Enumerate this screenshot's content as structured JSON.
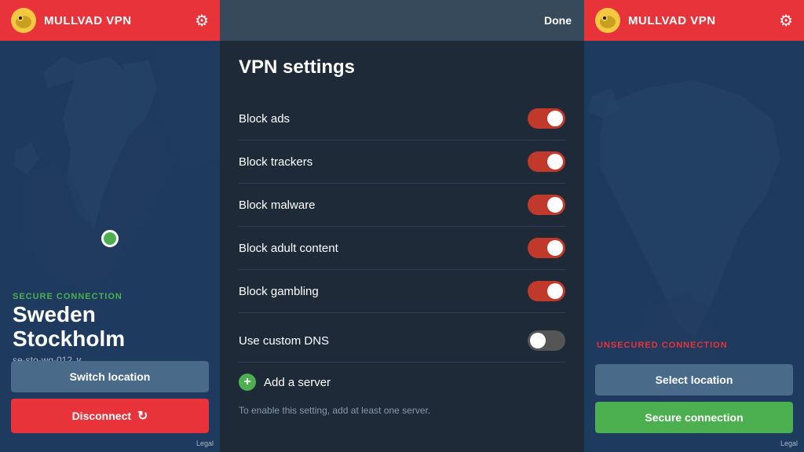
{
  "left": {
    "header": {
      "title": "MULLVAD VPN",
      "gear_label": "⚙"
    },
    "connection": {
      "status": "SECURE CONNECTION",
      "country": "Sweden",
      "city": "Stockholm",
      "server": "se-sto-wg-012"
    },
    "buttons": {
      "switch": "Switch location",
      "disconnect": "Disconnect"
    },
    "legal": "Legal"
  },
  "middle": {
    "done_label": "Done",
    "title": "VPN settings",
    "toggles": [
      {
        "label": "Block ads",
        "on": true
      },
      {
        "label": "Block trackers",
        "on": true
      },
      {
        "label": "Block malware",
        "on": true
      },
      {
        "label": "Block adult content",
        "on": true
      },
      {
        "label": "Block gambling",
        "on": true
      }
    ],
    "dns": {
      "label": "Use custom DNS",
      "on": false
    },
    "add_server": {
      "label": "Add a server",
      "icon": "+"
    },
    "hint": "To enable this setting, add at least one server."
  },
  "right": {
    "header": {
      "title": "MULLVAD VPN",
      "gear_label": "⚙"
    },
    "connection": {
      "status": "UNSECURED CONNECTION"
    },
    "buttons": {
      "select": "Select location",
      "secure": "Secure connection"
    },
    "legal": "Legal"
  },
  "icons": {
    "logo": "🐦",
    "gear": "⚙",
    "refresh": "↻",
    "chevron": "∨"
  }
}
